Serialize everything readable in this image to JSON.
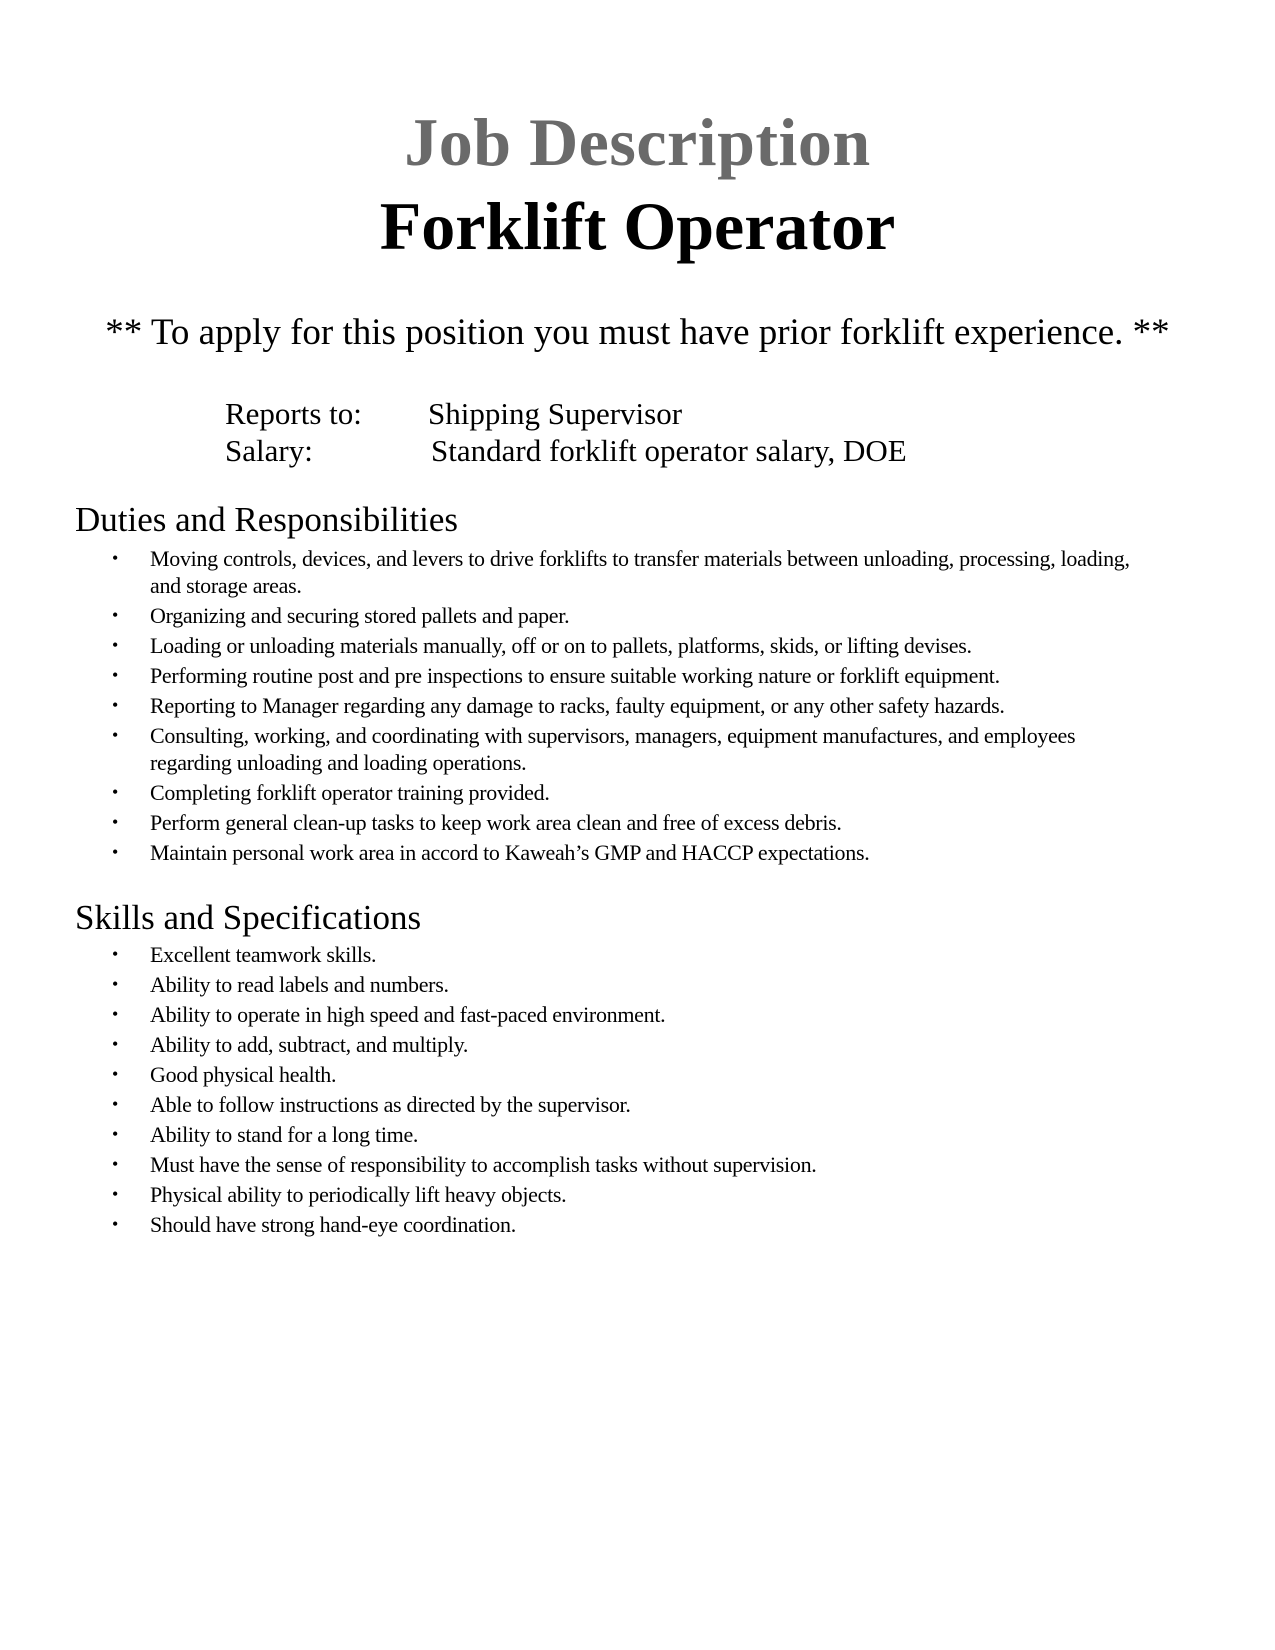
{
  "document": {
    "title_line1": "Job Description",
    "title_line2": "Forklift Operator",
    "notice": "** To apply for this position you must have prior forklift experience. **",
    "meta": {
      "reports_to_label": "Reports to:",
      "reports_to_value": "Shipping Supervisor",
      "salary_label": "Salary:",
      "salary_value": "Standard forklift operator salary, DOE"
    },
    "sections": [
      {
        "heading": "Duties and Responsibilities",
        "items": [
          "Moving controls, devices, and levers to drive forklifts to transfer materials between unloading, processing, loading, and storage areas.",
          "Organizing and securing stored pallets and paper.",
          "Loading or unloading materials manually, off or on to pallets, platforms, skids, or lifting devises.",
          "Performing routine post and pre inspections to ensure suitable working nature or forklift equipment.",
          "Reporting to Manager regarding any damage to racks, faulty equipment, or any other safety hazards.",
          "Consulting, working, and coordinating with supervisors, managers, equipment manufactures, and employees regarding unloading and loading operations.",
          "Completing forklift operator training provided.",
          "Perform general clean-up tasks to keep work area clean and free of excess debris.",
          "Maintain personal work area in accord to Kaweah’s GMP and HACCP expectations."
        ]
      },
      {
        "heading": "Skills and Specifications",
        "items": [
          "Excellent teamwork skills.",
          "Ability to read labels and numbers.",
          "Ability to operate in high speed and fast-paced environment.",
          "Ability to add, subtract, and multiply.",
          "Good physical health.",
          "Able to follow instructions as directed by the supervisor.",
          "Ability to stand for a long time.",
          "Must have the sense of responsibility to accomplish tasks without supervision.",
          "Physical ability to periodically lift heavy objects.",
          "Should have strong hand-eye coordination."
        ]
      }
    ],
    "bullet_glyph": "•"
  }
}
